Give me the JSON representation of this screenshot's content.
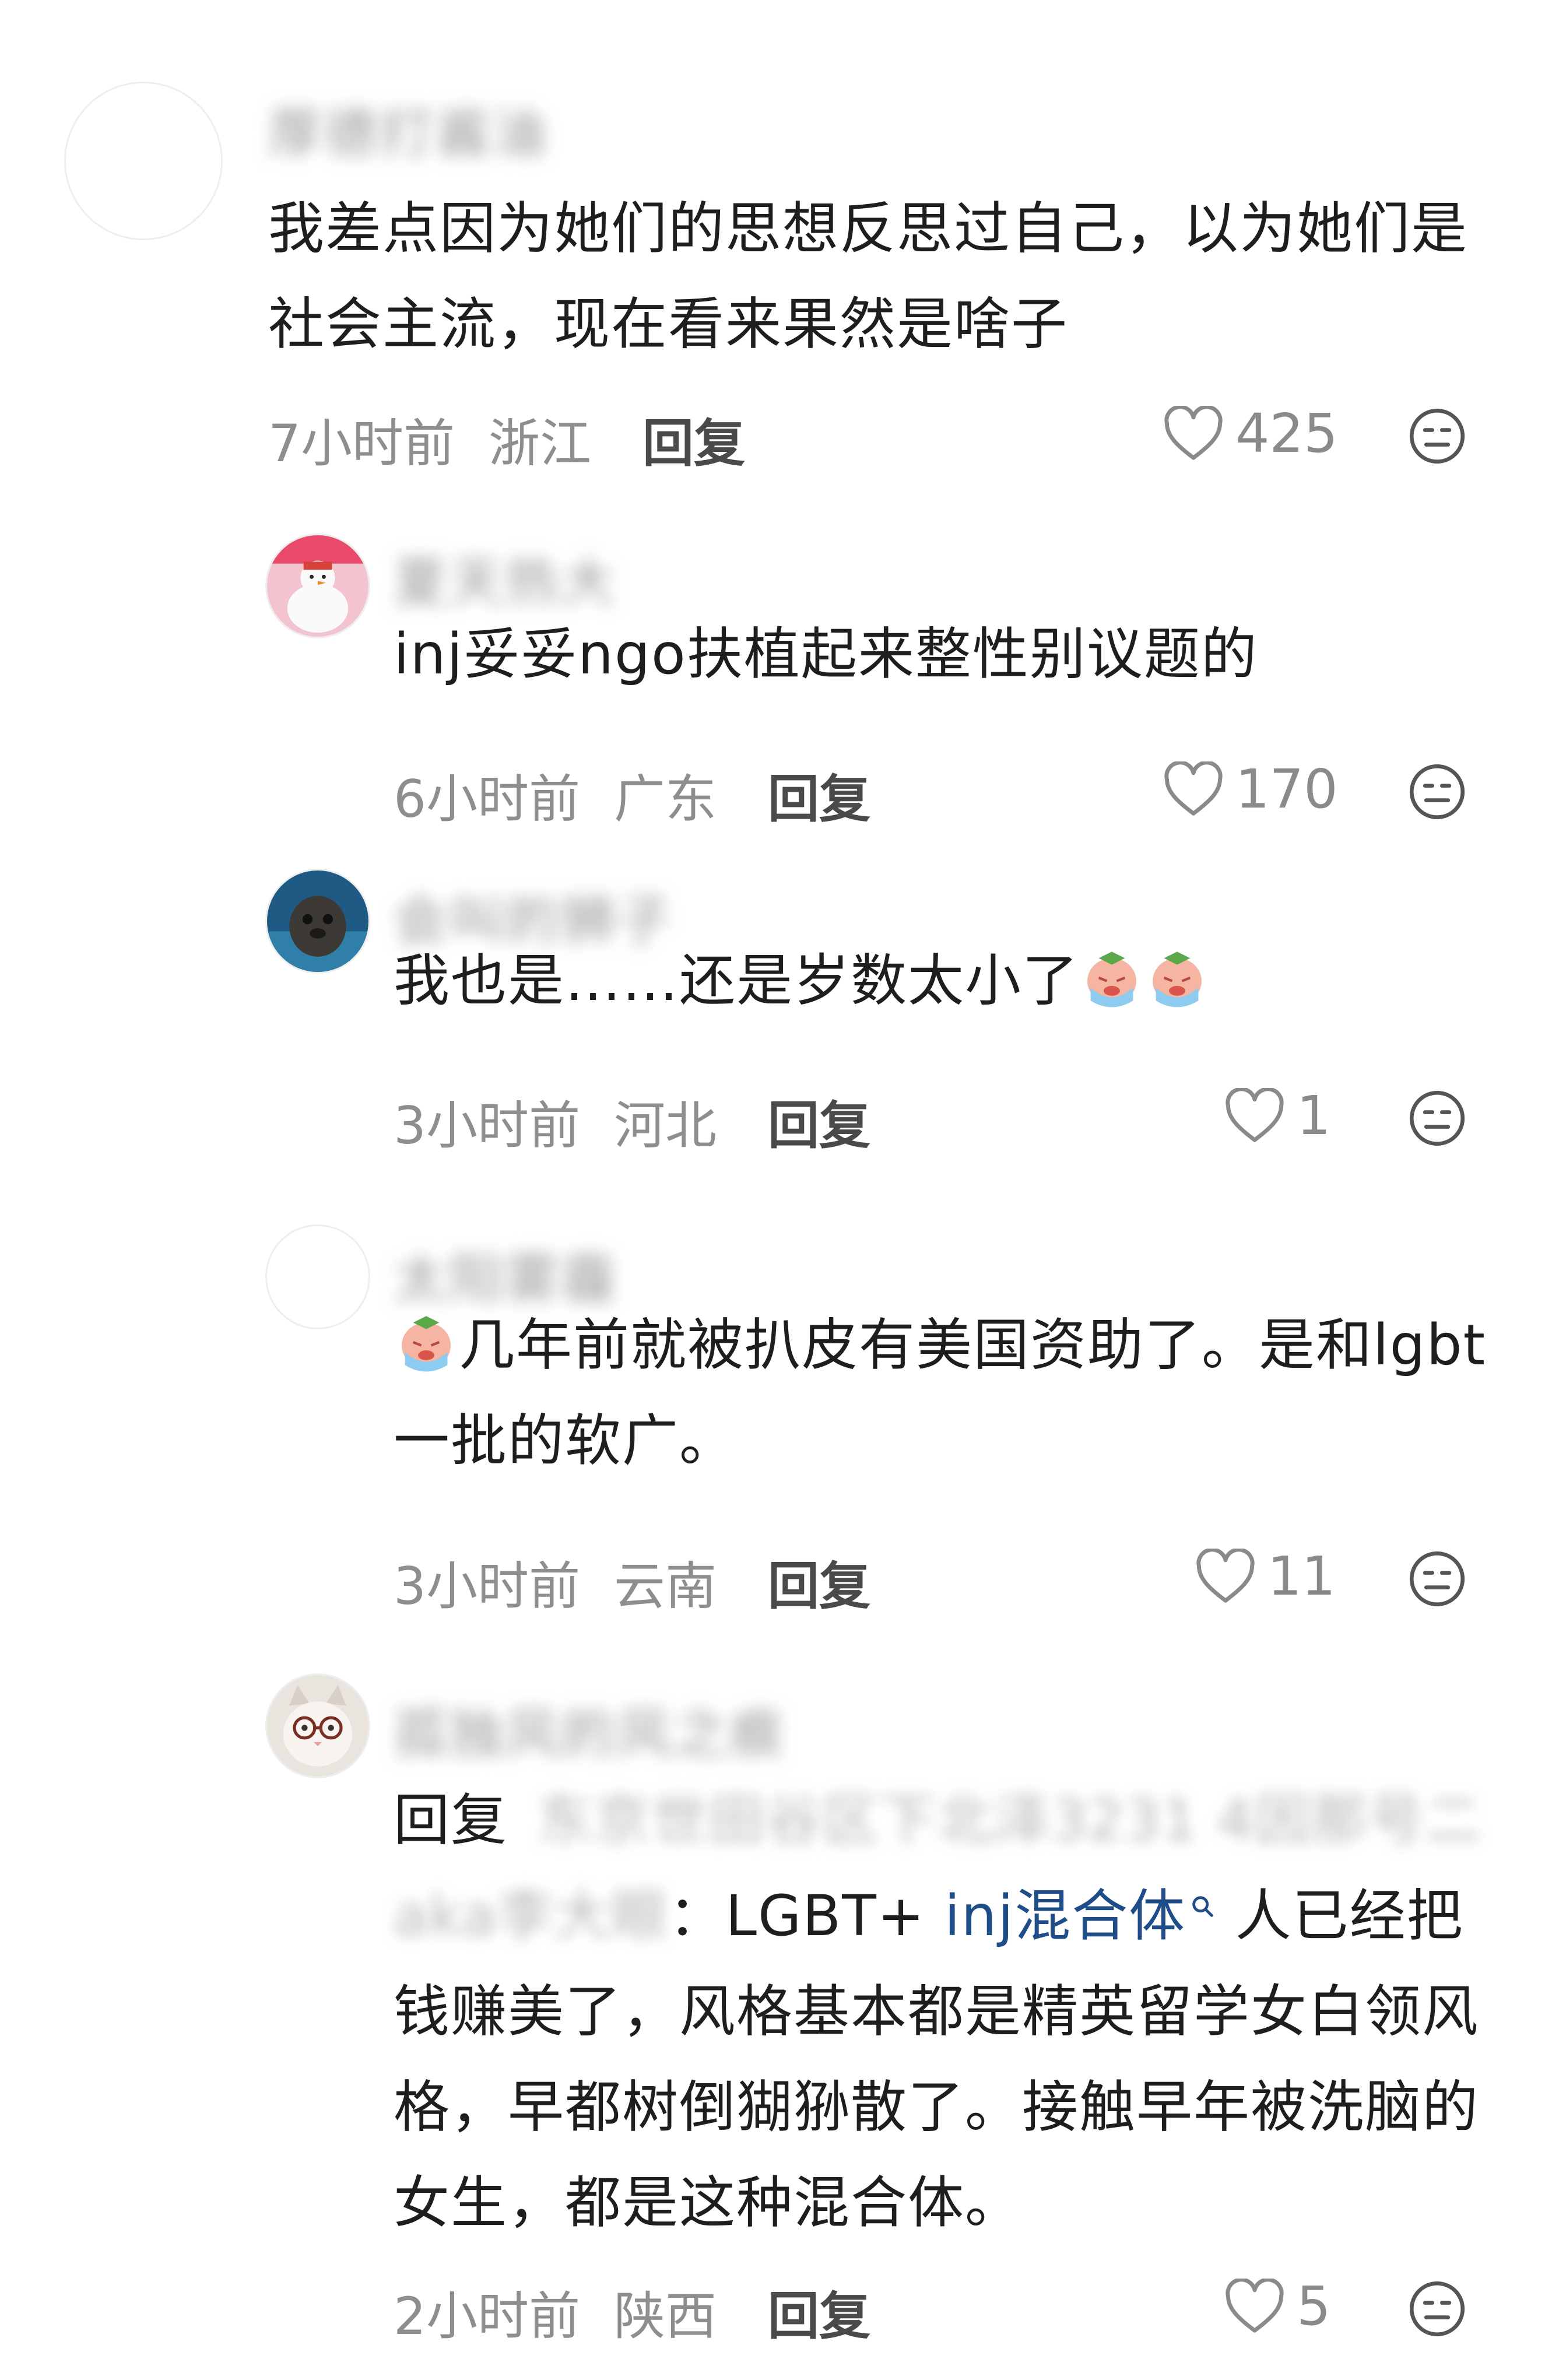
{
  "comments": [
    {
      "username": "厚德打酱油",
      "text": "我差点因为她们的思想反思过自己，以为她们是社会主流，现在看来果然是啥子",
      "time": "7小时前",
      "location": "浙江",
      "reply_label": "回复",
      "likes": "425"
    },
    {
      "username": "夏天热大",
      "text": "inj妥妥ngo扶植起来整性别议题的",
      "time": "6小时前",
      "location": "广东",
      "reply_label": "回复",
      "likes": "170"
    },
    {
      "username": "会叫的狮子",
      "text": "我也是……还是岁数太小了",
      "time": "3小时前",
      "location": "河北",
      "reply_label": "回复",
      "likes": "1"
    },
    {
      "username": "太阳雾霾",
      "text": "几年前就被扒皮有美国资助了。是和lgbt一批的软广。",
      "time": "3小时前",
      "location": "云南",
      "reply_label": "回复",
      "likes": "11"
    },
    {
      "username": "孤独风的风之痕",
      "reply_prefix": "回复",
      "reply_target": "东京世田谷区下北泽3231 4因那号二",
      "reply_target_2": "aka李大眼",
      "text_before_link": "：LGBT+ ",
      "link_text": "inj混合体",
      "text_after_link": " 人已经把钱赚美了，风格基本都是精英留学女白领风格，早都树倒猢狲散了。接触早年被洗脑的女生，都是这种混合体。",
      "time": "2小时前",
      "location": "陕西",
      "reply_label": "回复",
      "likes": "5"
    }
  ],
  "icons": {
    "like": "heart-outline-icon",
    "dislike": "neutral-face-icon",
    "emoji": "crying-face-emoji",
    "search": "search-icon"
  },
  "colors": {
    "link": "#1f4d89",
    "meta": "#8e8e8e",
    "text": "#1e1e1e"
  }
}
